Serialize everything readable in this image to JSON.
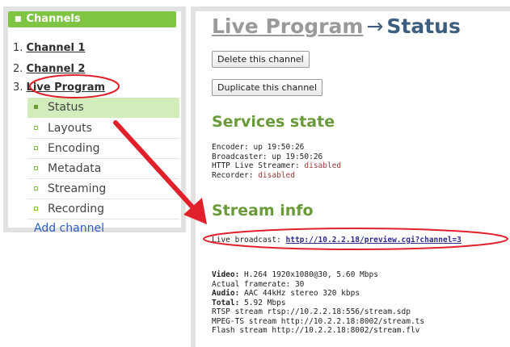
{
  "sidebar": {
    "header": "Channels",
    "channels": [
      {
        "num": "1.",
        "name": "Channel 1"
      },
      {
        "num": "2.",
        "name": "Channel 2"
      },
      {
        "num": "3.",
        "name": "Live Program"
      }
    ],
    "subitems": [
      {
        "label": "Status",
        "active": true
      },
      {
        "label": "Layouts",
        "active": false
      },
      {
        "label": "Encoding",
        "active": false
      },
      {
        "label": "Metadata",
        "active": false
      },
      {
        "label": "Streaming",
        "active": false
      },
      {
        "label": "Recording",
        "active": false
      }
    ],
    "add_channel": "Add channel"
  },
  "main": {
    "breadcrumb": "Live Program",
    "arrow": "→",
    "title": "Status",
    "buttons": {
      "delete": "Delete this channel",
      "duplicate": "Duplicate this channel"
    },
    "services": {
      "heading": "Services state",
      "encoder": "Encoder: up 19:50:26",
      "broadcaster": "Broadcaster: up 19:50:26",
      "http_label": "HTTP Live Streamer: ",
      "http_value": "disabled",
      "recorder_label": "Recorder: ",
      "recorder_value": "disabled"
    },
    "stream": {
      "heading": "Stream info",
      "live_label": "Live broadcast: ",
      "live_url": "http://10.2.2.18/preview.cgi?channel=3",
      "video_label": "Video:",
      "video_value": " H.264 1920x1080@30, 5.60 Mbps",
      "framerate": "Actual framerate: 30",
      "audio_label": "Audio:",
      "audio_value": " AAC 44kHz stereo 320 kbps",
      "total_label": "Total:",
      "total_value": " 5.92 Mbps",
      "rtsp": "RTSP stream rtsp://10.2.2.18:556/stream.sdp",
      "mpegts": "MPEG-TS stream http://10.2.2.18:8002/stream.ts",
      "flash": "Flash stream http://10.2.2.18:8002/stream.flv"
    }
  },
  "colors": {
    "accent_green": "#7fc443",
    "active_bg": "#d3ecbb",
    "heading_green": "#6a9a3a",
    "title_blue": "#3d5e7e",
    "annotation_red": "#e0202a"
  }
}
